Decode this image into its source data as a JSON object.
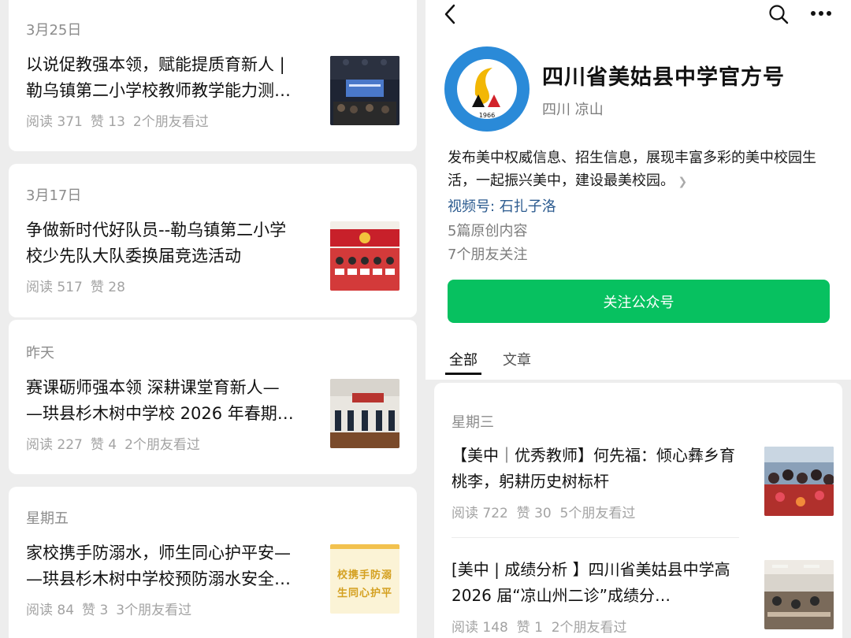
{
  "left_feed": [
    {
      "date": "3月25日",
      "title_l1": "以说促教强本领，赋能提质育新人 |",
      "title_l2": "勒乌镇第二小学校教师教学能力测…",
      "reads": "阅读 371",
      "likes": "赞 13",
      "friends": "2个朋友看过"
    },
    {
      "date": "3月17日",
      "title_l1": "争做新时代好队员--勒乌镇第二小学",
      "title_l2": "校少先队大队委换届竞选活动",
      "reads": "阅读 517",
      "likes": "赞 28",
      "friends": ""
    },
    {
      "date": "昨天",
      "title_l1": "赛课砺师强本领 深耕课堂育新人—",
      "title_l2": "—珙县杉木树中学校 2026 年春期…",
      "reads": "阅读 227",
      "likes": "赞 4",
      "friends": "2个朋友看过"
    },
    {
      "date": "星期五",
      "title_l1": "家校携手防溺水，师生同心护平安—",
      "title_l2": "—珙县杉木树中学校预防溺水安全…",
      "reads": "阅读 84",
      "likes": "赞 3",
      "friends": "3个朋友看过",
      "thumb_text_l1": "校携手防溺",
      "thumb_text_l2": "生同心护平"
    }
  ],
  "profile": {
    "name": "四川省美姑县中学官方号",
    "location": "四川 凉山",
    "description": "发布美中权威信息、招生信息，展现丰富多彩的美中校园生活，一起振兴美中，建设最美校园。",
    "video_label": "视频号: 石扎子洛",
    "original_count": "5篇原创内容",
    "friends_following": "7个朋友关注",
    "follow_button": "关注公众号",
    "logo_year": "1966"
  },
  "tabs": [
    "全部",
    "文章"
  ],
  "right_feed": [
    {
      "date": "星期三",
      "title": "【美中｜优秀教师】何先福：倾心彝乡育桃李，躬耕历史树标杆",
      "reads": "阅读 722",
      "likes": "赞 30",
      "friends": "5个朋友看过"
    },
    {
      "title": "[美中 | 成绩分析 】四川省美姑县中学高 2026 届“凉山州二诊”成绩分…",
      "reads": "阅读 148",
      "likes": "赞 1",
      "friends": "2个朋友看过"
    }
  ],
  "colors": {
    "accent_green": "#07c160",
    "link_blue": "#2c5b8f",
    "logo_blue": "#2a8ad8",
    "logo_gold": "#f2b705"
  },
  "icons": [
    "back-arrow-icon",
    "search-icon",
    "more-icon"
  ]
}
